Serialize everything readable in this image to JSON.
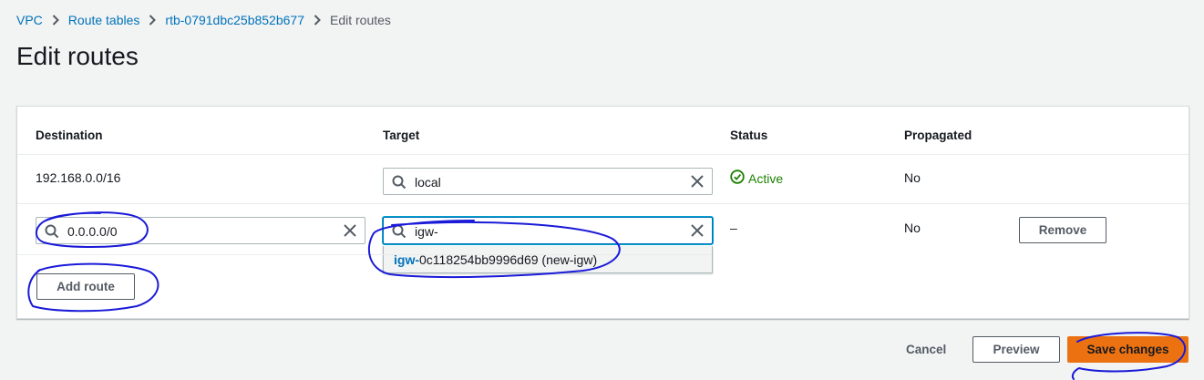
{
  "breadcrumb": {
    "items": [
      "VPC",
      "Route tables",
      "rtb-0791dbc25b852b677"
    ],
    "current": "Edit routes"
  },
  "page": {
    "title": "Edit routes"
  },
  "table": {
    "headers": {
      "destination": "Destination",
      "target": "Target",
      "status": "Status",
      "propagated": "Propagated"
    },
    "rows": [
      {
        "destination": "192.168.0.0/16",
        "target": "local",
        "status": "Active",
        "propagated": "No"
      },
      {
        "destination": "0.0.0.0/0",
        "target": "igw-",
        "status": "–",
        "propagated": "No",
        "remove_label": "Remove"
      }
    ],
    "target_suggestion": {
      "match": "igw-",
      "rest": "0c118254bb9996d69 (new-igw)"
    },
    "add_route_label": "Add route"
  },
  "footer": {
    "cancel_label": "Cancel",
    "preview_label": "Preview",
    "save_label": "Save changes"
  },
  "icons": {
    "search": "search-icon",
    "clear": "close-icon",
    "status": "check-circle-icon",
    "separator": "chevron-right-icon"
  },
  "colors": {
    "link": "#0073bb",
    "success": "#1d8102",
    "primary": "#ec7211",
    "annotation": "#1a1ad8"
  }
}
